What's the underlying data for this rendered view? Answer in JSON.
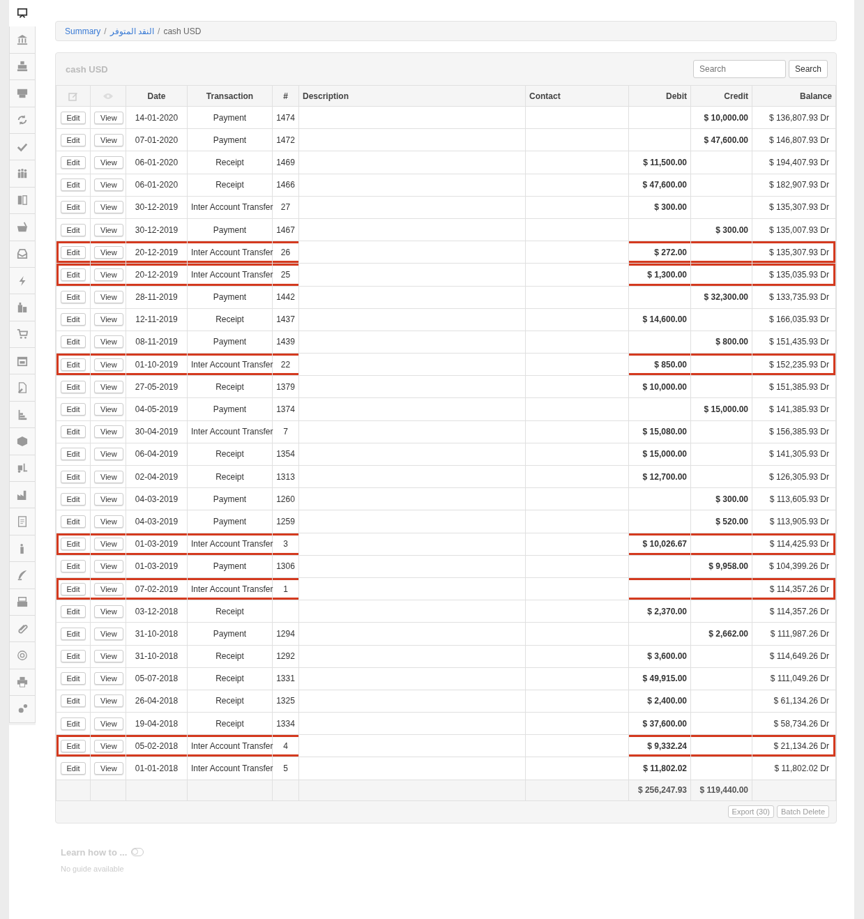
{
  "breadcrumb": [
    {
      "label": "Summary",
      "link": true
    },
    {
      "separator": "/",
      "label": "النقد المتوفر",
      "link": true
    },
    {
      "separator": "/",
      "label": "cash USD",
      "link": false
    }
  ],
  "panel": {
    "title": "cash USD",
    "search": {
      "placeholder": "Search",
      "button": "Search"
    }
  },
  "table": {
    "columns": [
      "Date",
      "Transaction",
      "#",
      "Description",
      "Contact",
      "Debit",
      "Credit",
      "Balance"
    ],
    "rows": [
      {
        "date": "14-01-2020",
        "transaction": "Payment",
        "number": "1474",
        "credit": "$ 10,000.00",
        "balance": "$ 136,807.93 Dr",
        "highlighted": false
      },
      {
        "date": "07-01-2020",
        "transaction": "Payment",
        "number": "1472",
        "credit": "$ 47,600.00",
        "balance": "$ 146,807.93 Dr",
        "highlighted": false
      },
      {
        "date": "06-01-2020",
        "transaction": "Receipt",
        "number": "1469",
        "debit": "$ 11,500.00",
        "balance": "$ 194,407.93 Dr",
        "highlighted": false
      },
      {
        "date": "06-01-2020",
        "transaction": "Receipt",
        "number": "1466",
        "debit": "$ 47,600.00",
        "balance": "$ 182,907.93 Dr",
        "highlighted": false
      },
      {
        "date": "30-12-2019",
        "transaction": "Inter Account Transfer",
        "number": "27",
        "debit": "$ 300.00",
        "balance": "$ 135,307.93 Dr",
        "highlighted": false
      },
      {
        "date": "30-12-2019",
        "transaction": "Payment",
        "number": "1467",
        "credit": "$ 300.00",
        "balance": "$ 135,007.93 Dr",
        "highlighted": false
      },
      {
        "date": "20-12-2019",
        "transaction": "Inter Account Transfer",
        "number": "26",
        "debit": "$ 272.00",
        "balance": "$ 135,307.93 Dr",
        "highlighted": true
      },
      {
        "date": "20-12-2019",
        "transaction": "Inter Account Transfer",
        "number": "25",
        "debit": "$ 1,300.00",
        "balance": "$ 135,035.93 Dr",
        "highlighted": true
      },
      {
        "date": "28-11-2019",
        "transaction": "Payment",
        "number": "1442",
        "credit": "$ 32,300.00",
        "balance": "$ 133,735.93 Dr",
        "highlighted": false
      },
      {
        "date": "12-11-2019",
        "transaction": "Receipt",
        "number": "1437",
        "debit": "$ 14,600.00",
        "balance": "$ 166,035.93 Dr",
        "highlighted": false
      },
      {
        "date": "08-11-2019",
        "transaction": "Payment",
        "number": "1439",
        "credit": "$ 800.00",
        "balance": "$ 151,435.93 Dr",
        "highlighted": false
      },
      {
        "date": "01-10-2019",
        "transaction": "Inter Account Transfer",
        "number": "22",
        "debit": "$ 850.00",
        "balance": "$ 152,235.93 Dr",
        "highlighted": true
      },
      {
        "date": "27-05-2019",
        "transaction": "Receipt",
        "number": "1379",
        "debit": "$ 10,000.00",
        "balance": "$ 151,385.93 Dr",
        "highlighted": false
      },
      {
        "date": "04-05-2019",
        "transaction": "Payment",
        "number": "1374",
        "credit": "$ 15,000.00",
        "balance": "$ 141,385.93 Dr",
        "highlighted": false
      },
      {
        "date": "30-04-2019",
        "transaction": "Inter Account Transfer",
        "number": "7",
        "debit": "$ 15,080.00",
        "balance": "$ 156,385.93 Dr",
        "highlighted": false
      },
      {
        "date": "06-04-2019",
        "transaction": "Receipt",
        "number": "1354",
        "debit": "$ 15,000.00",
        "balance": "$ 141,305.93 Dr",
        "highlighted": false
      },
      {
        "date": "02-04-2019",
        "transaction": "Receipt",
        "number": "1313",
        "debit": "$ 12,700.00",
        "balance": "$ 126,305.93 Dr",
        "highlighted": false
      },
      {
        "date": "04-03-2019",
        "transaction": "Payment",
        "number": "1260",
        "credit": "$ 300.00",
        "balance": "$ 113,605.93 Dr",
        "highlighted": false
      },
      {
        "date": "04-03-2019",
        "transaction": "Payment",
        "number": "1259",
        "credit": "$ 520.00",
        "balance": "$ 113,905.93 Dr",
        "highlighted": false
      },
      {
        "date": "01-03-2019",
        "transaction": "Inter Account Transfer",
        "number": "3",
        "debit": "$ 10,026.67",
        "balance": "$ 114,425.93 Dr",
        "highlighted": true
      },
      {
        "date": "01-03-2019",
        "transaction": "Payment",
        "number": "1306",
        "credit": "$ 9,958.00",
        "balance": "$ 104,399.26 Dr",
        "highlighted": false
      },
      {
        "date": "07-02-2019",
        "transaction": "Inter Account Transfer",
        "number": "1",
        "balance": "$ 114,357.26 Dr",
        "highlighted": true
      },
      {
        "date": "03-12-2018",
        "transaction": "Receipt",
        "debit": "$ 2,370.00",
        "balance": "$ 114,357.26 Dr",
        "highlighted": false
      },
      {
        "date": "31-10-2018",
        "transaction": "Payment",
        "number": "1294",
        "credit": "$ 2,662.00",
        "balance": "$ 111,987.26 Dr",
        "highlighted": false
      },
      {
        "date": "31-10-2018",
        "transaction": "Receipt",
        "number": "1292",
        "debit": "$ 3,600.00",
        "balance": "$ 114,649.26 Dr",
        "highlighted": false
      },
      {
        "date": "05-07-2018",
        "transaction": "Receipt",
        "number": "1331",
        "debit": "$ 49,915.00",
        "balance": "$ 111,049.26 Dr",
        "highlighted": false
      },
      {
        "date": "26-04-2018",
        "transaction": "Receipt",
        "number": "1325",
        "debit": "$ 2,400.00",
        "balance": "$ 61,134.26 Dr",
        "highlighted": false
      },
      {
        "date": "19-04-2018",
        "transaction": "Receipt",
        "number": "1334",
        "debit": "$ 37,600.00",
        "balance": "$ 58,734.26 Dr",
        "highlighted": false
      },
      {
        "date": "05-02-2018",
        "transaction": "Inter Account Transfer",
        "number": "4",
        "debit": "$ 9,332.24",
        "balance": "$ 21,134.26 Dr",
        "highlighted": true
      },
      {
        "date": "01-01-2018",
        "transaction": "Inter Account Transfer",
        "number": "5",
        "debit": "$ 11,802.02",
        "balance": "$ 11,802.02 Dr",
        "highlighted": false
      }
    ],
    "row_buttons": [
      {
        "edit": "Edit",
        "view": "View"
      },
      {
        "edit": "Edit",
        "view": "View"
      },
      {
        "edit": "Edit",
        "view": "View"
      },
      {
        "edit": "Edit",
        "view": "View"
      },
      {
        "edit": "Edit",
        "view": "View"
      },
      {
        "edit": "Edit",
        "view": "View"
      },
      {
        "edit": "Edit",
        "view": "View"
      },
      {
        "edit": "Edit",
        "view": "View"
      },
      {
        "edit": "Edit",
        "view": "View"
      },
      {
        "edit": "Edit",
        "view": "View"
      },
      {
        "edit": "Edit",
        "view": "View"
      },
      {
        "edit": "Edit",
        "view": "View"
      },
      {
        "edit": "Edit",
        "view": "View"
      },
      {
        "edit": "Edit",
        "view": "View"
      },
      {
        "edit": "Edit",
        "view": "View"
      },
      {
        "edit": "Edit",
        "view": "View"
      },
      {
        "edit": "Edit",
        "view": "View"
      },
      {
        "edit": "Edit",
        "view": "View"
      },
      {
        "edit": "Edit",
        "view": "View"
      },
      {
        "edit": "Edit",
        "view": "View"
      },
      {
        "edit": "Edit",
        "view": "View"
      },
      {
        "edit": "Edit",
        "view": "View"
      },
      {
        "edit": "Edit",
        "view": "View"
      },
      {
        "edit": "Edit",
        "view": "View"
      },
      {
        "edit": "Edit",
        "view": "View"
      },
      {
        "edit": "Edit",
        "view": "View"
      },
      {
        "edit": "Edit",
        "view": "View"
      },
      {
        "edit": "Edit",
        "view": "View"
      },
      {
        "edit": "Edit",
        "view": "View"
      },
      {
        "edit": "Edit",
        "view": "View"
      }
    ],
    "totals": {
      "debit": "$ 256,247.93",
      "credit": "$ 119,440.00"
    }
  },
  "footer_buttons": [
    "Export (30)",
    "Batch Delete"
  ],
  "guide": {
    "title": "Learn how to ...",
    "on": false,
    "note": "No guide available"
  }
}
